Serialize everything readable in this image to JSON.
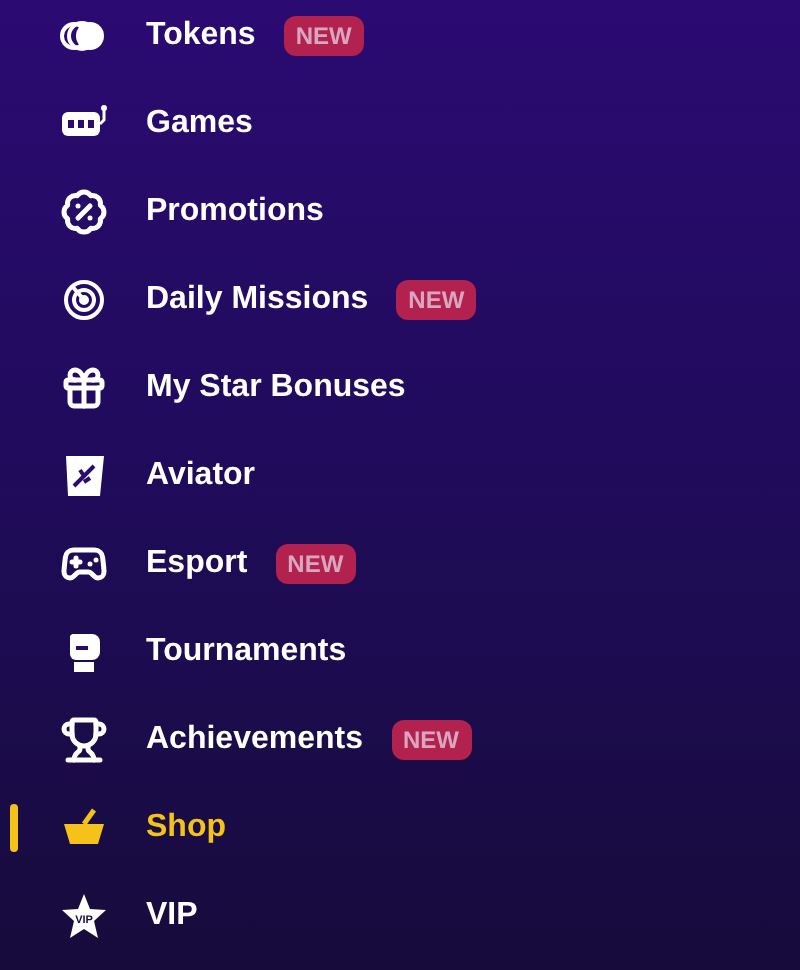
{
  "menu": {
    "items": [
      {
        "label": "Tokens",
        "badge": "NEW",
        "selected": false
      },
      {
        "label": "Games",
        "selected": false
      },
      {
        "label": "Promotions",
        "selected": false
      },
      {
        "label": "Daily Missions",
        "badge": "NEW",
        "selected": false
      },
      {
        "label": "My Star Bonuses",
        "selected": false
      },
      {
        "label": "Aviator",
        "selected": false
      },
      {
        "label": "Esport",
        "badge": "NEW",
        "selected": false
      },
      {
        "label": "Tournaments",
        "selected": false
      },
      {
        "label": "Achievements",
        "badge": "NEW",
        "selected": false
      },
      {
        "label": "Shop",
        "selected": true
      },
      {
        "label": "VIP",
        "icon_label": "VIP",
        "selected": false
      }
    ]
  }
}
